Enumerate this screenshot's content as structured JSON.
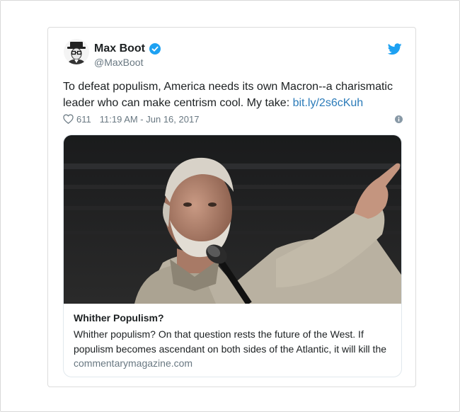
{
  "author": {
    "name": "Max Boot",
    "handle": "@MaxBoot",
    "verified": true
  },
  "tweet": {
    "text": "To defeat populism, America needs its own Macron--a charismatic leader who can make centrism cool. My take: ",
    "link_text": "bit.ly/2s6cKuh",
    "likes": "611",
    "timestamp": "11:19 AM - Jun 16, 2017"
  },
  "link_card": {
    "title": "Whither Populism?",
    "description": "Whither populism? On that question rests the future of the West. If populism becomes ascendant on both sides of the Atlantic, it will kill the",
    "domain": "commentarymagazine.com"
  },
  "colors": {
    "link": "#2b7bb9",
    "verified": "#1da1f2",
    "twitter_brand": "#1da1f2",
    "text": "#1c2022",
    "muted": "#697882"
  },
  "icons": {
    "verified": "verified-badge-icon",
    "brand": "twitter-bird-icon",
    "like": "heart-icon",
    "info": "info-icon"
  }
}
